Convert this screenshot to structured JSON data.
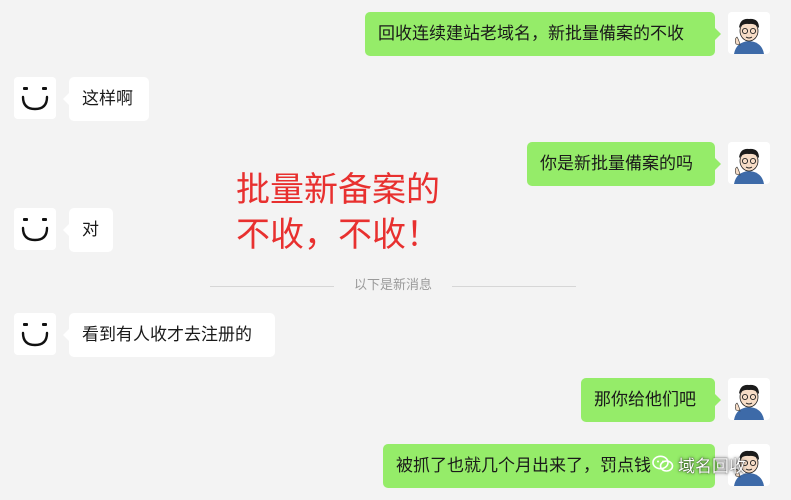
{
  "messages": [
    {
      "side": "out",
      "text": "回收连续建站老域名，新批量備案的不收"
    },
    {
      "side": "in",
      "text": "这样啊"
    },
    {
      "side": "out",
      "text": "你是新批量備案的吗"
    },
    {
      "side": "in",
      "text": "对"
    },
    {
      "side": "in",
      "text": "看到有人收才去注册的"
    },
    {
      "side": "out",
      "text": "那你给他们吧"
    },
    {
      "side": "out",
      "text": "被抓了也就几个月出来了，罚点钱"
    }
  ],
  "divider": {
    "label": "以下是新消息"
  },
  "overlay": {
    "line1": "批量新备案的",
    "line2": "不收，不收！"
  },
  "watermark": {
    "text": "域名回收"
  },
  "colors": {
    "background": "#f3f3f3",
    "outgoing": "#95ec69",
    "incoming": "#ffffff",
    "overlay": "#e8302f"
  },
  "avatars": {
    "incoming": "smiley-avatar",
    "outgoing": "cartoon-man-avatar"
  }
}
